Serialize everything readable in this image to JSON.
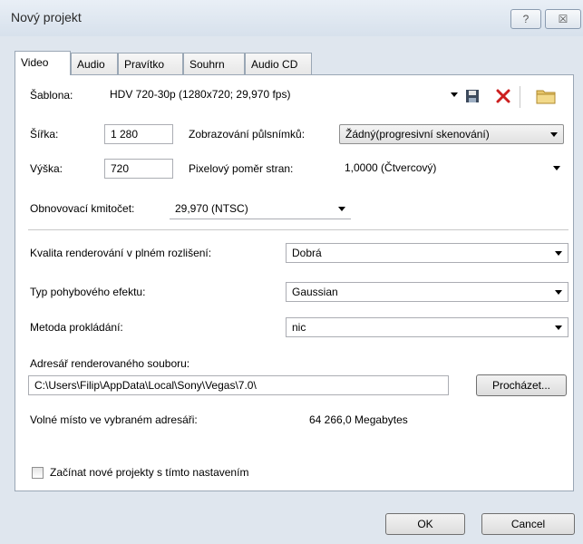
{
  "window": {
    "title": "Nový projekt",
    "help_glyph": "?",
    "close_glyph": "☒"
  },
  "tabs": [
    {
      "label": "Video",
      "active": true
    },
    {
      "label": "Audio",
      "active": false
    },
    {
      "label": "Pravítko",
      "active": false
    },
    {
      "label": "Souhrn",
      "active": false
    },
    {
      "label": "Audio CD",
      "active": false
    }
  ],
  "video": {
    "template_label": "Šablona:",
    "template_value": "HDV 720-30p (1280x720; 29,970 fps)",
    "width_label": "Šířka:",
    "width_value": "1 280",
    "height_label": "Výška:",
    "height_value": "720",
    "field_order_label": "Zobrazování půlsnímků:",
    "field_order_value": "Žádný(progresivní skenování)",
    "pixel_aspect_label": "Pixelový poměr stran:",
    "pixel_aspect_value": "1,0000 (Čtvercový)",
    "frame_rate_label": "Obnovovací kmitočet:",
    "frame_rate_value": "29,970 (NTSC)",
    "render_quality_label": "Kvalita renderování v plném rozlišení:",
    "render_quality_value": "Dobrá",
    "motion_blur_label": "Typ pohybového efektu:",
    "motion_blur_value": "Gaussian",
    "deinterlace_label": "Metoda prokládání:",
    "deinterlace_value": "nic",
    "render_folder_label": "Adresář renderovaného souboru:",
    "render_folder_value": "C:\\Users\\Filip\\AppData\\Local\\Sony\\Vegas\\7.0\\",
    "browse_label": "Procházet...",
    "free_space_label": "Volné místo ve vybraném adresáři:",
    "free_space_value": "64 266,0 Megabytes",
    "start_new_label": "Začínat nové projekty s tímto nastavením",
    "start_new_checked": false
  },
  "footer": {
    "ok_label": "OK",
    "cancel_label": "Cancel"
  },
  "colors": {
    "delete_icon": "#cc1f1f",
    "folder_icon": "#e6c56a"
  }
}
